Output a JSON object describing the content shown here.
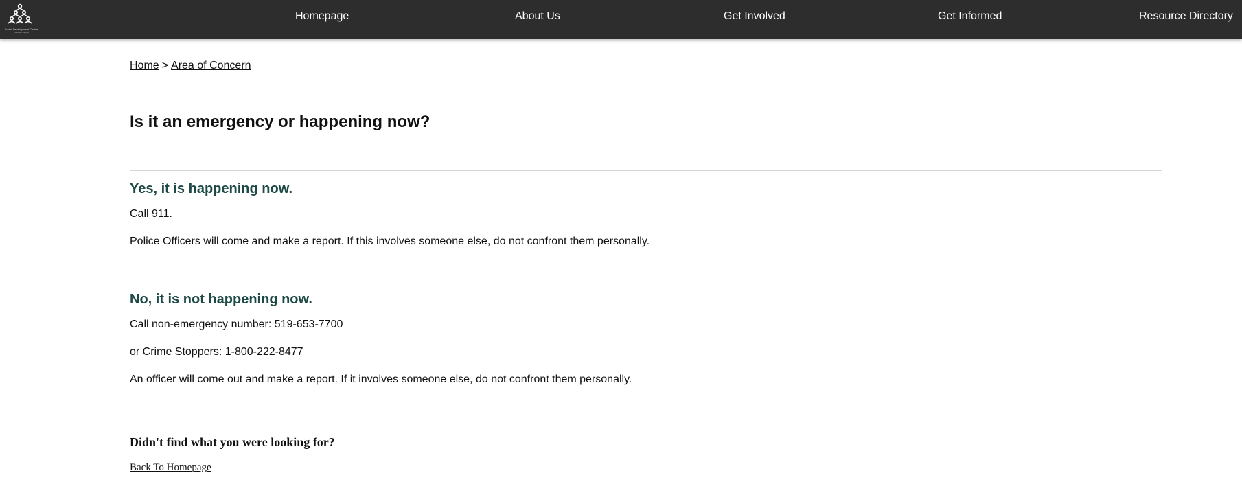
{
  "header": {
    "logo": {
      "icon": "people-tree-logo-icon",
      "name": "Social Development Centre",
      "tagline": "Waterloo Region"
    },
    "nav": [
      {
        "label": "Homepage"
      },
      {
        "label": "About Us"
      },
      {
        "label": "Get Involved"
      },
      {
        "label": "Get Informed"
      },
      {
        "label": "Resource Directory"
      }
    ]
  },
  "breadcrumb": {
    "home": "Home",
    "separator": ">",
    "current": "Area of Concern"
  },
  "page_title": "Is it an emergency or happening now?",
  "sections": [
    {
      "title": "Yes, it is happening now.",
      "paragraphs": [
        "Call 911.",
        "Police Officers will come and make a report. If this involves someone else, do not confront them personally."
      ]
    },
    {
      "title": "No, it is not happening now.",
      "paragraphs": [
        "Call non-emergency number: 519-653-7700",
        "or Crime Stoppers: 1-800-222-8477",
        "An officer will come out and make a report. If it involves someone else, do not confront them personally."
      ]
    }
  ],
  "footer": {
    "question": "Didn't find what you were looking for?",
    "back_link": "Back To Homepage"
  },
  "colors": {
    "header_bg": "#2d2d2d",
    "section_title": "#1d4a47",
    "divider": "#d4d4d4"
  }
}
